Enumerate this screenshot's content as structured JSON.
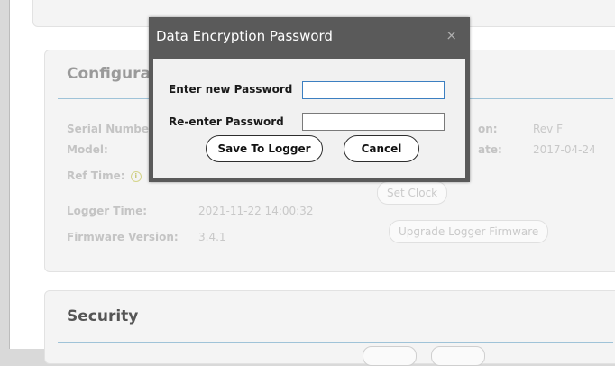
{
  "config": {
    "title": "Configurat",
    "rows": [
      {
        "label": "Serial Number",
        "value": ""
      },
      {
        "label": "Model:",
        "value": ""
      },
      {
        "label": "Ref Time:",
        "value": ""
      },
      {
        "label": "Logger Time:",
        "value": "2021-11-22 14:00:32"
      },
      {
        "label": "Firmware Version:",
        "value": "3.4.1"
      }
    ],
    "right_rows": [
      {
        "label": "on:",
        "value": "Rev F"
      },
      {
        "label": "ate:",
        "value": "2017-04-24"
      }
    ],
    "info_icon": "info-icon",
    "set_clock_label": "Set Clock",
    "upgrade_label": "Upgrade Logger Firmware"
  },
  "security": {
    "title": "Security"
  },
  "dialog": {
    "title": "Data Encryption Password",
    "close_glyph": "×",
    "new_password_label": "Enter new Password",
    "new_password_value": "",
    "reenter_label": "Re-enter Password",
    "reenter_value": "",
    "save_label": "Save To Logger",
    "cancel_label": "Cancel"
  }
}
